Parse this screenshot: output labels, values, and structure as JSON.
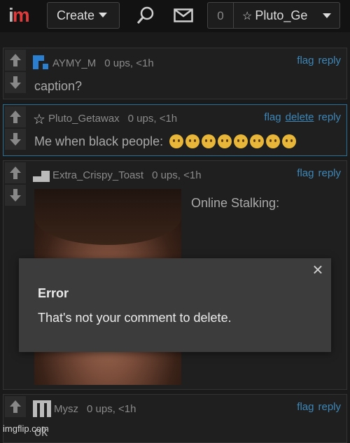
{
  "header": {
    "logo_i": "i",
    "logo_m": "m",
    "create_label": "Create",
    "notif_count": "0",
    "username": "Pluto_Ge"
  },
  "comments": [
    {
      "username": "AYMY_M",
      "stats": "0 ups, <1h",
      "actions": [
        "flag",
        "reply"
      ],
      "text": "caption?"
    },
    {
      "username": "Pluto_Getawax",
      "stats": "0 ups, <1h",
      "actions": [
        "flag",
        "delete",
        "reply"
      ],
      "text": "Me when black people:",
      "emoji_count": 8
    },
    {
      "username": "Extra_Crispy_Toast",
      "stats": "0 ups, <1h",
      "actions": [
        "flag",
        "reply"
      ],
      "caption": "Online Stalking:"
    },
    {
      "username": "Mysz",
      "stats": "0 ups, <1h",
      "actions": [
        "flag",
        "reply"
      ],
      "text": "ok"
    }
  ],
  "dialog": {
    "title": "Error",
    "message": "That's not your comment to delete.",
    "close": "×"
  },
  "watermark": "imgflip.com",
  "colors": {
    "link": "#3d87b8",
    "brand_red": "#e03a3a",
    "own_border": "#2a6f95"
  }
}
